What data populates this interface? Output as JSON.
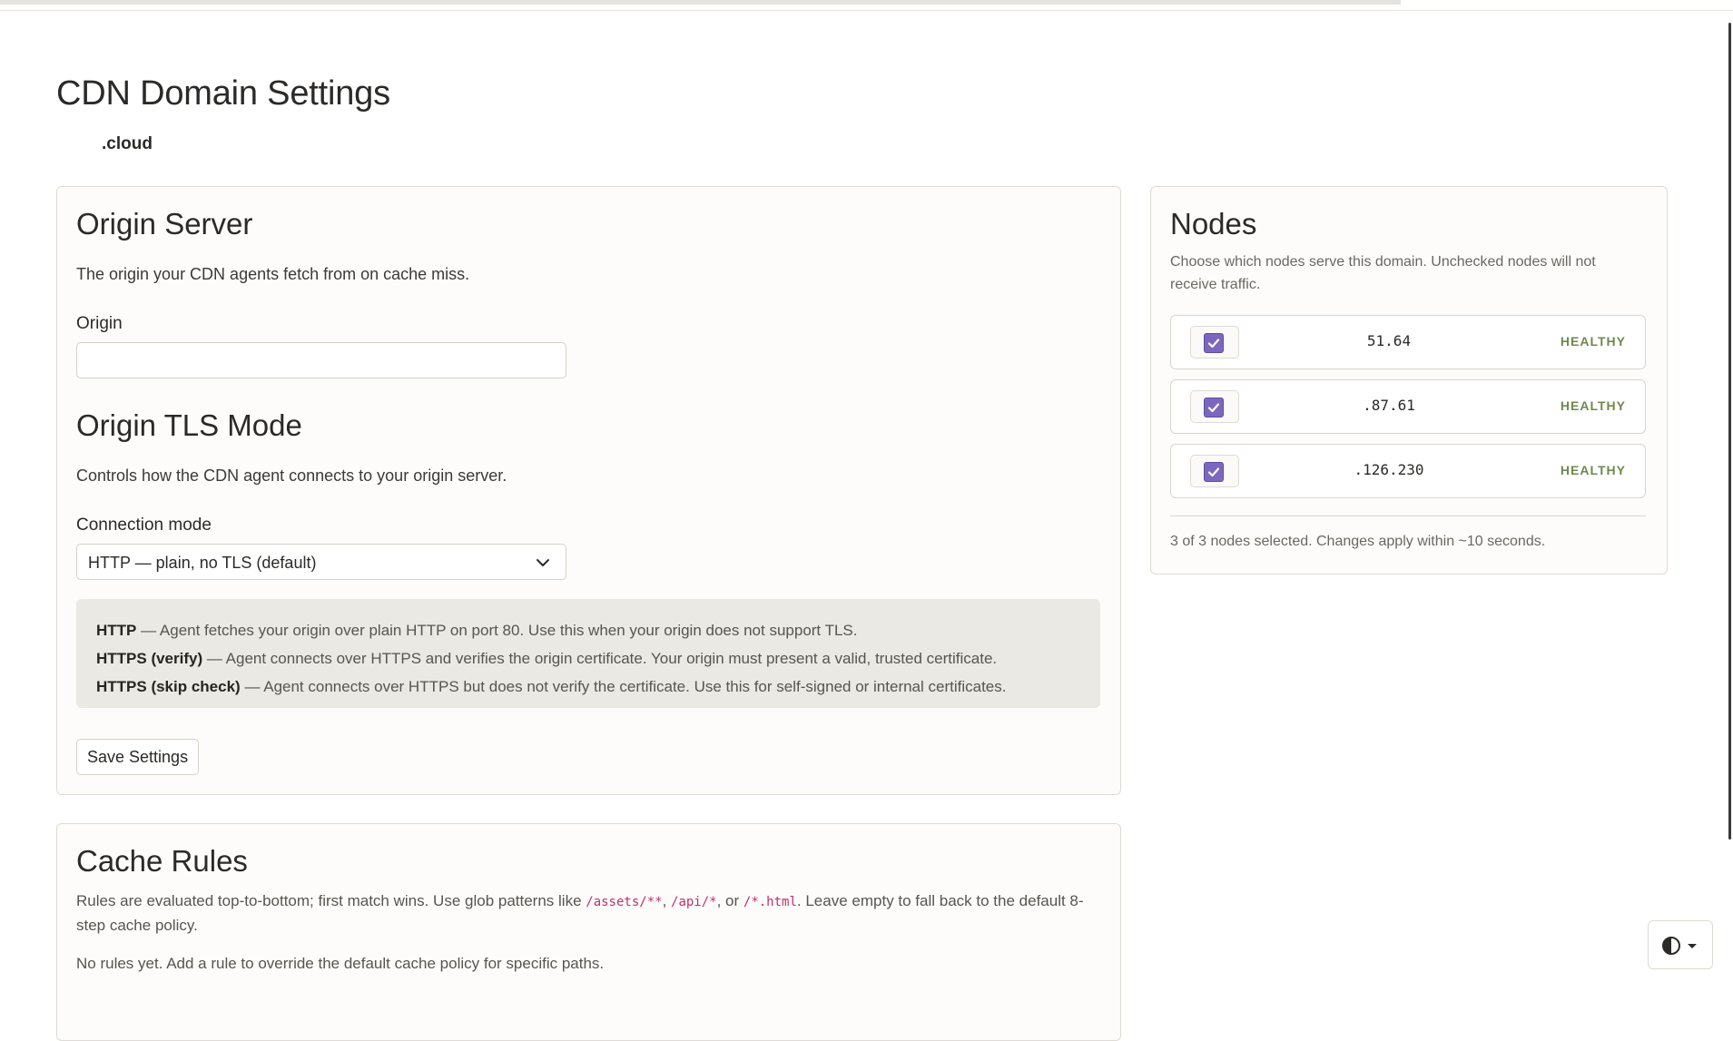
{
  "page": {
    "title": "CDN Domain Settings",
    "domain": ".cloud"
  },
  "origin": {
    "heading": "Origin Server",
    "description": "The origin your CDN agents fetch from on cache miss.",
    "field_label": "Origin",
    "field_value": ""
  },
  "tls": {
    "heading": "Origin TLS Mode",
    "description": "Controls how the CDN agent connects to your origin server.",
    "select_label": "Connection mode",
    "selected_option": "HTTP — plain, no TLS (default)",
    "info": [
      {
        "term": "HTTP",
        "text": " — Agent fetches your origin over plain HTTP on port 80. Use this when your origin does not support TLS."
      },
      {
        "term": "HTTPS (verify)",
        "text": " — Agent connects over HTTPS and verifies the origin certificate. Your origin must present a valid, trusted certificate."
      },
      {
        "term": "HTTPS (skip check)",
        "text": " — Agent connects over HTTPS but does not verify the certificate. Use this for self-signed or internal certificates."
      }
    ],
    "save_label": "Save Settings"
  },
  "nodes": {
    "heading": "Nodes",
    "description": "Choose which nodes serve this domain. Unchecked nodes will not receive traffic.",
    "items": [
      {
        "ip": "51.64",
        "status": "HEALTHY",
        "checked": true
      },
      {
        "ip": ".87.61",
        "status": "HEALTHY",
        "checked": true
      },
      {
        "ip": ".126.230",
        "status": "HEALTHY",
        "checked": true
      }
    ],
    "summary": "3 of 3 nodes selected. Changes apply within ~10 seconds."
  },
  "cache": {
    "heading": "Cache Rules",
    "desc_part1": "Rules are evaluated top-to-bottom; first match wins. Use glob patterns like ",
    "code1": "/assets/**",
    "sep1": ", ",
    "code2": "/api/*",
    "sep2": ", or ",
    "code3": "/*.html",
    "desc_part2": ". Leave empty to fall back to the default 8-step cache policy.",
    "empty_text": "No rules yet. Add a rule to override the default cache policy for specific paths."
  },
  "colors": {
    "accent": "#7b68be",
    "healthy": "#6e8a4c",
    "code": "#c0306a"
  },
  "icons": {
    "select": "chevron-down-icon",
    "checkbox": "check-icon",
    "theme": "contrast-icon"
  }
}
